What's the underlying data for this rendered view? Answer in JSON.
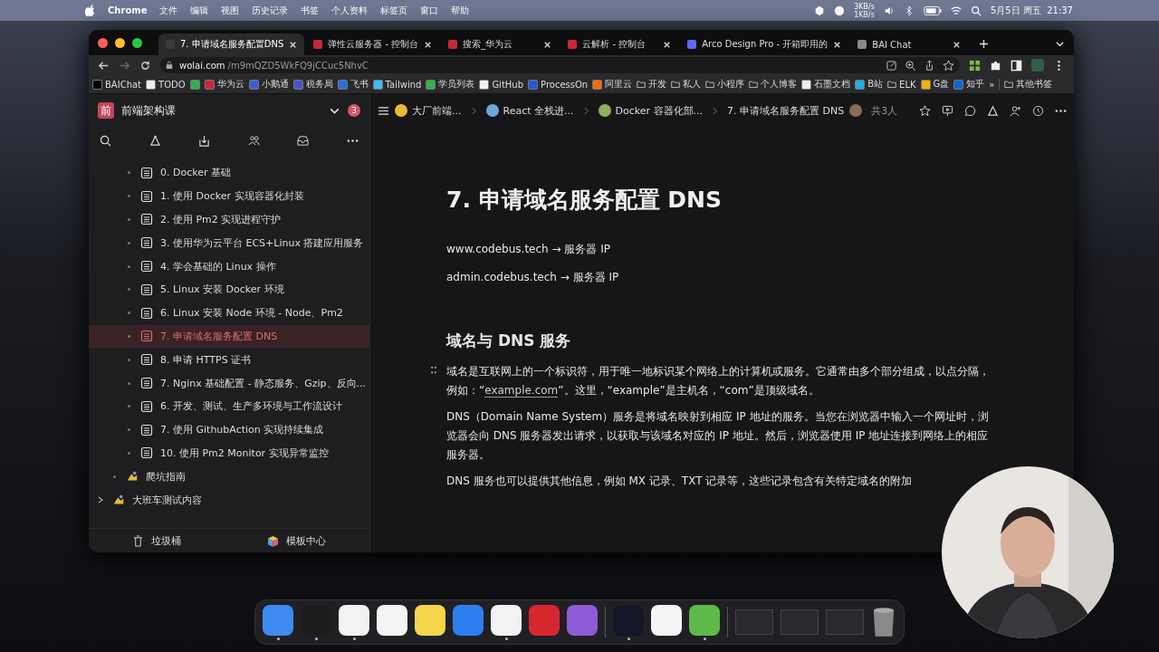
{
  "menu_bar": {
    "app": "Chrome",
    "menus": [
      "文件",
      "编辑",
      "视图",
      "历史记录",
      "书签",
      "个人资料",
      "标签页",
      "窗口",
      "帮助"
    ],
    "net_up": "3KB/s",
    "net_down": "1KB/s",
    "clock": "5月5日 周五  21:37"
  },
  "browser": {
    "tabs": [
      {
        "title": "7. 申请域名服务配置DNS",
        "selected": true,
        "color": "#3a3a3a"
      },
      {
        "title": "弹性云服务器 - 控制台",
        "selected": false,
        "color": "#c7283a"
      },
      {
        "title": "搜索_华为云",
        "selected": false,
        "color": "#c7283a"
      },
      {
        "title": "云解析 - 控制台",
        "selected": false,
        "color": "#c7283a"
      },
      {
        "title": "Arco Design Pro - 开箱即用的",
        "selected": false,
        "color": "#5b6cf0"
      },
      {
        "title": "BAI Chat",
        "selected": false,
        "color": "#888888"
      }
    ],
    "url_host": "wolai.com",
    "url_path": "/m9mQZD5WkFQ9jCCuc5NhvC",
    "bookmarks": [
      {
        "label": "BAIChat",
        "kind": "site",
        "color": "#000000"
      },
      {
        "label": "TODO",
        "kind": "site",
        "color": "#eeeeee"
      },
      {
        "kind": "site",
        "color": "#2fb34a"
      },
      {
        "label": "华为云",
        "kind": "site",
        "color": "#c7283a"
      },
      {
        "label": "小鹅通",
        "kind": "site",
        "color": "#3d5bd9"
      },
      {
        "label": "税务局",
        "kind": "site",
        "color": "#4a55c8"
      },
      {
        "label": "飞书",
        "kind": "site",
        "color": "#2b6ee0"
      },
      {
        "label": "Tailwind",
        "kind": "site",
        "color": "#38bdf8"
      },
      {
        "label": "学员列表",
        "kind": "site",
        "color": "#2fb34a"
      },
      {
        "label": "GitHub",
        "kind": "site",
        "color": "#f0f0f0"
      },
      {
        "label": "ProcessOn",
        "kind": "site",
        "color": "#2458d8"
      },
      {
        "label": "阿里云",
        "kind": "site",
        "color": "#ff6a00"
      },
      {
        "label": "开发",
        "kind": "folder"
      },
      {
        "label": "私人",
        "kind": "folder"
      },
      {
        "label": "小程序",
        "kind": "folder"
      },
      {
        "label": "个人博客",
        "kind": "folder"
      },
      {
        "label": "石墨文档",
        "kind": "site",
        "color": "#eeeeee"
      },
      {
        "label": "B站",
        "kind": "site",
        "color": "#23ade5"
      },
      {
        "label": "ELK",
        "kind": "folder"
      },
      {
        "label": "G盘",
        "kind": "site",
        "color": "#f4b400"
      },
      {
        "label": "知乎",
        "kind": "site",
        "color": "#0a66dd"
      }
    ],
    "overflow": "»",
    "other_bookmarks": "其他书签"
  },
  "sidebar": {
    "logo": "前",
    "workspace": "前端架构课",
    "badge": "3",
    "tree": [
      {
        "children": [
          {
            "children": [
              {
                "label": "0. Docker 基础",
                "selected": false
              },
              {
                "label": "1. 使用 Docker 实现容器化封装",
                "selected": false
              },
              {
                "label": "2. 使用 Pm2 实现进程守护",
                "selected": false
              },
              {
                "label": "3. 使用华为云平台 ECS+Linux 搭建应用服务",
                "selected": false
              },
              {
                "label": "4. 学会基础的 Linux 操作",
                "selected": false
              },
              {
                "label": "5. Linux 安装 Docker 环境",
                "selected": false
              },
              {
                "label": "6. Linux 安装 Node 环境 - Node、Pm2",
                "selected": false
              },
              {
                "label": "7. 申请域名服务配置 DNS",
                "selected": true
              },
              {
                "label": "8. 申请 HTTPS 证书",
                "selected": false
              },
              {
                "label": "7. Nginx 基础配置 - 静态服务、Gzip、反向...",
                "selected": false
              },
              {
                "label": "6. 开发、测试、生产多环境与工作流设计",
                "selected": false
              },
              {
                "label": "7. 使用 GithubAction 实现持续集成",
                "selected": false
              },
              {
                "label": "10. 使用 Pm2 Monitor 实现异常监控",
                "selected": false
              }
            ]
          },
          {
            "label": "爬坑指南",
            "selected": false
          }
        ]
      },
      {
        "label": "大班车测试内容",
        "selected": false,
        "expanded": false
      }
    ],
    "footer": [
      "垃圾桶",
      "模板中心"
    ]
  },
  "breadcrumbs": [
    "大厂前端...",
    "React 全栈进...",
    "Docker 容器化部...",
    "7. 申请域名服务配置 DNS"
  ],
  "collaborators": "共3人",
  "document": {
    "title": "7. 申请域名服务配置 DNS",
    "mappings": [
      {
        "host": "www.codebus.tech",
        "arrow": "→",
        "target": "服务器 IP"
      },
      {
        "host": "admin.codebus.tech",
        "arrow": "→",
        "target": "服务器 IP"
      }
    ],
    "heading": "域名与 DNS 服务",
    "paragraphs": [
      [
        {
          "text": "域名是互联网上的一个标识符，用于唯一地标识某个网络上的计算机或服务。它通常由多个部分组成，以点分隔，例如：“"
        },
        {
          "text": "example.com",
          "kind": "link"
        },
        {
          "text": "”。这里，“example”是主机名，“com”是顶级域名。"
        }
      ],
      [
        {
          "text": "DNS（Domain Name System）服务是将域名映射到相应 IP 地址的服务。当您在浏览器中输入一个网址时，浏览器会向 DNS 服务器发出请求，以获取与该域名对应的 IP 地址。然后，浏览器使用 IP 地址连接到网络上的相应服务器。"
        }
      ],
      [
        {
          "text": "DNS 服务也可以提供其他信息，例如 MX 记录、TXT 记录等，这些记录包含有关特定域名的附加"
        }
      ]
    ]
  },
  "dock": [
    {
      "kind": "finder",
      "running": true
    },
    {
      "kind": "terminal",
      "running": true
    },
    {
      "kind": "chrome",
      "running": true
    },
    {
      "kind": "typora",
      "running": false
    },
    {
      "kind": "notes",
      "running": false
    },
    {
      "kind": "keynote",
      "running": false
    },
    {
      "kind": "vscode",
      "running": true
    },
    {
      "kind": "music",
      "running": false
    },
    {
      "kind": "downloader",
      "running": false
    },
    {
      "kind": "obs",
      "running": true
    },
    {
      "kind": "slack",
      "running": false
    },
    {
      "kind": "camtasia",
      "running": true
    }
  ]
}
